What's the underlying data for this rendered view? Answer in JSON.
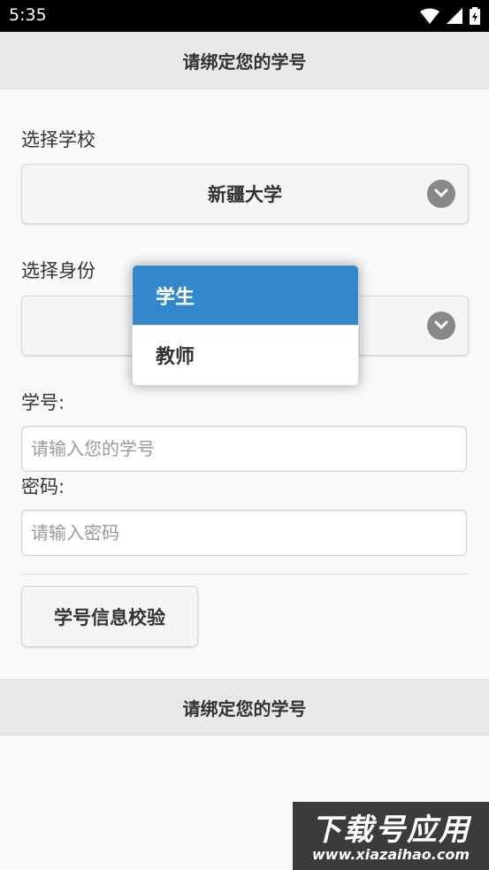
{
  "status_bar": {
    "time": "5:35"
  },
  "header": {
    "title": "请绑定您的学号"
  },
  "school": {
    "label": "选择学校",
    "value": "新疆大学"
  },
  "identity": {
    "label": "选择身份",
    "value": ""
  },
  "student_id": {
    "label": "学号:",
    "placeholder": "请输入您的学号"
  },
  "password": {
    "label": "密码:",
    "placeholder": "请输入密码"
  },
  "verify_button": {
    "label": "学号信息校验"
  },
  "footer": {
    "title": "请绑定您的学号"
  },
  "dropdown": {
    "options": [
      "学生",
      "教师"
    ],
    "selected_index": 0
  },
  "watermark": {
    "title": "下载号应用",
    "url": "www.xiazaihao.com"
  },
  "colors": {
    "selected_option": "#3388cc",
    "header_bg": "#e9e9e9",
    "page_bg": "#f9f9f9"
  }
}
